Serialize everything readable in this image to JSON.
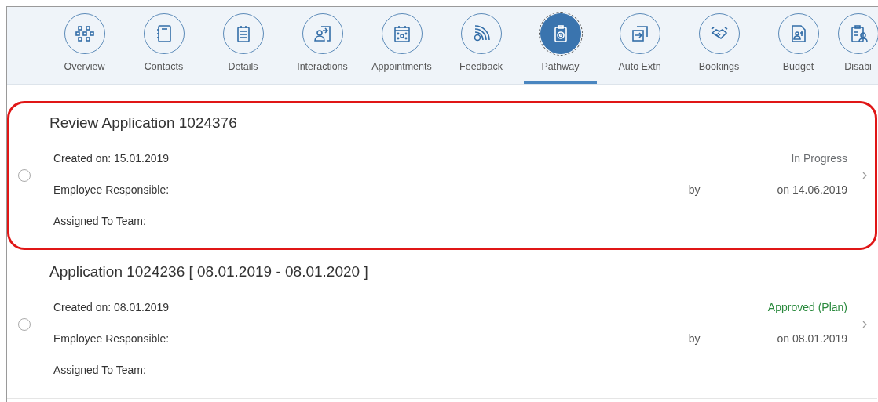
{
  "tabs": [
    {
      "label": "Overview",
      "selected": false
    },
    {
      "label": "Contacts",
      "selected": false
    },
    {
      "label": "Details",
      "selected": false
    },
    {
      "label": "Interactions",
      "selected": false
    },
    {
      "label": "Appointments",
      "selected": false
    },
    {
      "label": "Feedback",
      "selected": false
    },
    {
      "label": "Pathway",
      "selected": true
    },
    {
      "label": "Auto Extn",
      "selected": false
    },
    {
      "label": "Bookings",
      "selected": false
    },
    {
      "label": "Budget",
      "selected": false
    },
    {
      "label": "Disabi",
      "selected": false
    }
  ],
  "items": [
    {
      "title": "Review Application 1024376",
      "created": "Created on: 15.01.2019",
      "employee": "Employee Responsible:",
      "team": "Assigned To Team:",
      "status": "In Progress",
      "color": "#6a6d70",
      "by": "by",
      "date": "on 14.06.2019",
      "selected": false,
      "highlighted": true
    },
    {
      "title": "Application 1024236 [ 08.01.2019 - 08.01.2020 ]",
      "created": "Created on: 08.01.2019",
      "employee": "Employee Responsible:",
      "team": "Assigned To Team:",
      "status": "Approved (Plan)",
      "color": "#2b8a3e",
      "by": "by",
      "date": "on 08.01.2019",
      "selected": false,
      "highlighted": false
    }
  ]
}
